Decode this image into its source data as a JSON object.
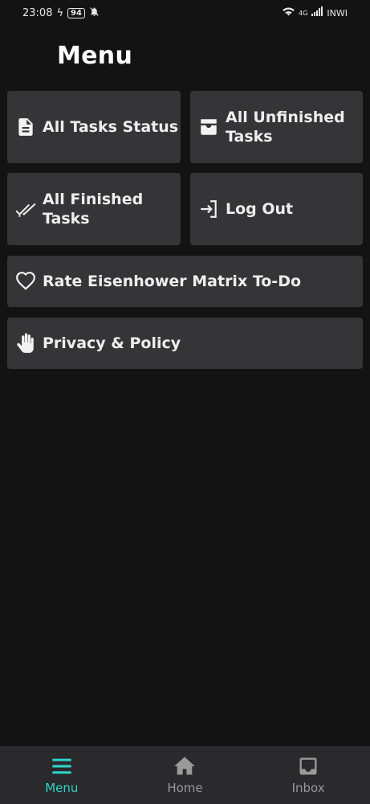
{
  "status_bar": {
    "time": "23:08",
    "battery": "94",
    "network": "4G",
    "carrier": "INWI"
  },
  "page": {
    "title": "Menu"
  },
  "menu": {
    "items": [
      {
        "label": "All Tasks Status",
        "icon": "document-icon"
      },
      {
        "label": "All Unfinished\nTasks",
        "icon": "inbox-tray-icon"
      },
      {
        "label": "All Finished\nTasks",
        "icon": "double-check-icon"
      },
      {
        "label": "Log Out",
        "icon": "login-arrow-icon"
      },
      {
        "label": "Rate Eisenhower Matrix To-Do",
        "icon": "heart-icon"
      },
      {
        "label": "Privacy & Policy",
        "icon": "hand-icon"
      }
    ]
  },
  "bottom_nav": {
    "items": [
      {
        "label": "Menu",
        "icon": "hamburger-icon",
        "active": true
      },
      {
        "label": "Home",
        "icon": "home-icon",
        "active": false
      },
      {
        "label": "Inbox",
        "icon": "inbox-icon",
        "active": false
      }
    ]
  },
  "colors": {
    "background": "#141314",
    "card": "#353436",
    "nav_background": "#2a292b",
    "accent": "#2fd4c9",
    "inactive": "#9a9a9a"
  }
}
